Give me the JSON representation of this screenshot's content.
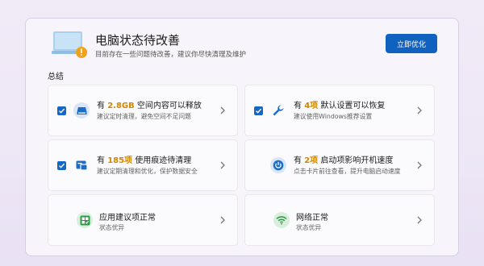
{
  "header": {
    "title": "电脑状态待改善",
    "subtitle": "目前存在一些问题待改善，建议你尽快清理及维护",
    "optimize_button": "立即优化"
  },
  "summary": {
    "title": "总结",
    "cards": [
      {
        "prefix": "有 ",
        "highlight": "2.8GB",
        "suffix": " 空间内容可以释放",
        "desc": "建议定时清理，避免空间不足问题",
        "icon": "disk-icon",
        "checked": true
      },
      {
        "prefix": "有 ",
        "highlight": "4项",
        "suffix": " 默认设置可以恢复",
        "desc": "建议使用Windows推荐设置",
        "icon": "wrench-icon",
        "checked": true
      },
      {
        "prefix": "有 ",
        "highlight": "185项",
        "suffix": " 使用痕迹待清理",
        "desc": "建议定期清理和优化，保护数据安全",
        "icon": "trace-icon",
        "checked": true
      },
      {
        "prefix": "有 ",
        "highlight": "2项",
        "suffix": " 启动项影响开机速度",
        "desc": "点击卡片前往查看，提升电脑启动速度",
        "icon": "power-icon",
        "checked": false
      },
      {
        "prefix": "",
        "highlight": "",
        "suffix": "应用建议项正常",
        "desc": "状态优异",
        "icon": "app-shield-icon",
        "checked": false
      },
      {
        "prefix": "",
        "highlight": "",
        "suffix": "网络正常",
        "desc": "状态优异",
        "icon": "wifi-icon",
        "checked": false
      }
    ]
  },
  "colors": {
    "accent": "#0f62c0",
    "highlight": "#d48500",
    "checkbox": "#1667c4"
  }
}
